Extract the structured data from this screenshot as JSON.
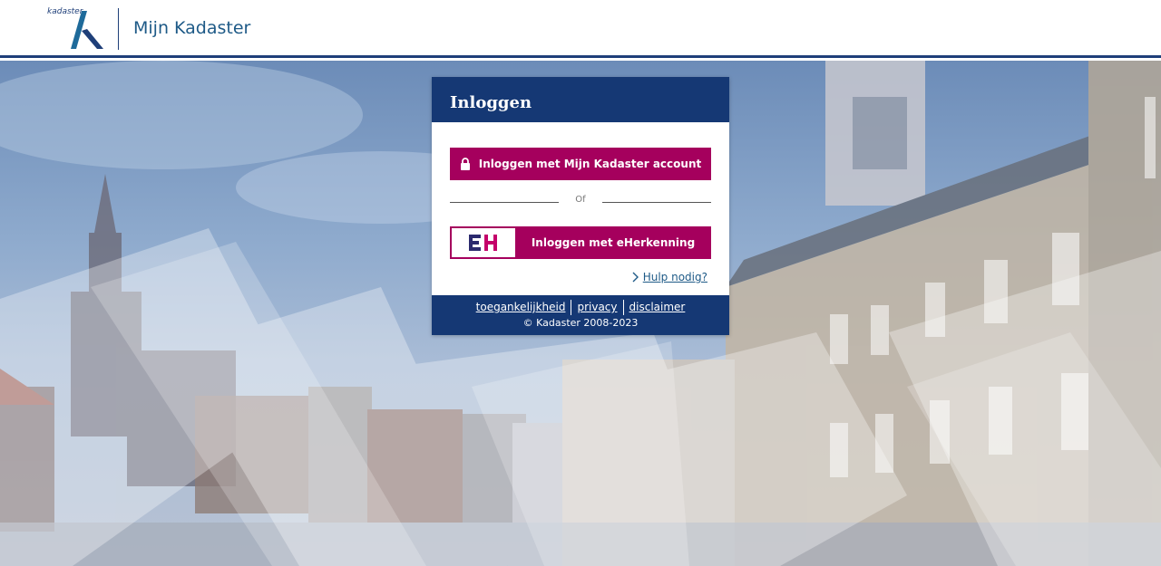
{
  "header": {
    "logo_text": "kadaster",
    "app_title": "Mijn Kadaster"
  },
  "card": {
    "title": "Inloggen",
    "primary_button_label": "Inloggen met Mijn Kadaster account",
    "divider_text": "Of",
    "eh_logo_text": "EH",
    "eh_button_label": "Inloggen met eHerkenning",
    "help_link": "Hulp nodig?"
  },
  "footer": {
    "links": [
      "toegankelijkheid",
      "privacy",
      "disclaimer"
    ],
    "copyright": "© Kadaster 2008-2023"
  },
  "colors": {
    "brand_navy": "#153874",
    "accent_magenta": "#a5005d",
    "link_blue": "#1e5a87"
  },
  "icons": {
    "lock": "lock-icon",
    "chevron": "chevron-right-icon"
  }
}
